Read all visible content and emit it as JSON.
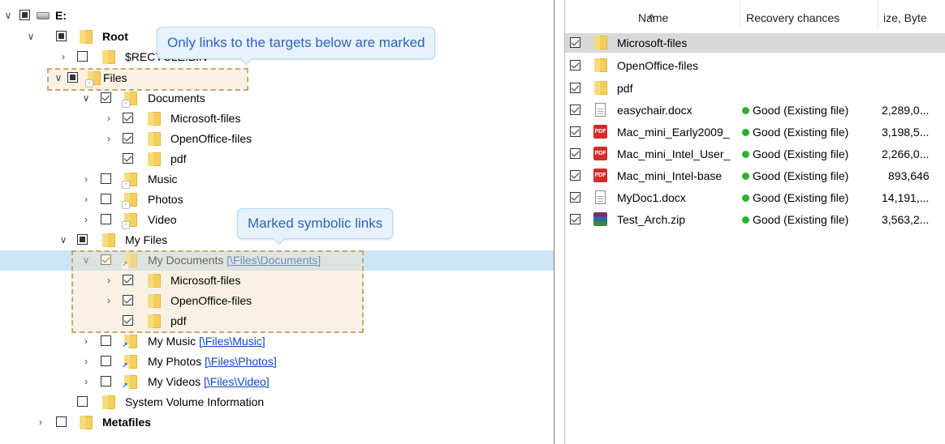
{
  "tree": {
    "drive_label": "E:",
    "root": "Root",
    "recycle": "$RECYCLE.BIN",
    "files": "Files",
    "documents": "Documents",
    "ms_files": "Microsoft-files",
    "oo_files": "OpenOffice-files",
    "pdf": "pdf",
    "music": "Music",
    "photos": "Photos",
    "video": "Video",
    "my_files": "My Files",
    "my_documents": "My Documents",
    "my_documents_target": "[\\Files\\Documents]",
    "my_music": "My Music",
    "my_music_target": "[\\Files\\Music]",
    "my_photos": "My Photos",
    "my_photos_target": "[\\Files\\Photos]",
    "my_videos": "My Videos",
    "my_videos_target": "[\\Files\\Video]",
    "system_volume": "System Volume Information",
    "metafiles": "Metafiles"
  },
  "callouts": {
    "targets": "Only links to the targets below are marked",
    "symlinks": "Marked symbolic links"
  },
  "file_list": {
    "columns": {
      "name": "Name",
      "recovery": "Recovery chances",
      "size": "ize, Byte"
    },
    "rows": [
      {
        "name": "Microsoft-files",
        "recovery": "",
        "size": ""
      },
      {
        "name": "OpenOffice-files",
        "recovery": "",
        "size": ""
      },
      {
        "name": "pdf",
        "recovery": "",
        "size": ""
      },
      {
        "name": "easychair.docx",
        "recovery": "Good (Existing file)",
        "size": "2,289,0..."
      },
      {
        "name": "Mac_mini_Early2009_",
        "recovery": "Good (Existing file)",
        "size": "3,198,5..."
      },
      {
        "name": "Mac_mini_Intel_User_",
        "recovery": "Good (Existing file)",
        "size": "2,266,0..."
      },
      {
        "name": "Mac_mini_Intel-base",
        "recovery": "Good (Existing file)",
        "size": "893,646"
      },
      {
        "name": "MyDoc1.docx",
        "recovery": "Good (Existing file)",
        "size": "14,191,..."
      },
      {
        "name": "Test_Arch.zip",
        "recovery": "Good (Existing file)",
        "size": "3,563,2..."
      }
    ]
  },
  "colors": {
    "selection": "#cce4f7",
    "status_good": "#2cb22c",
    "link": "#0a46c3",
    "callout_text": "#2d63b4"
  },
  "pdf_icon_text": "PDF"
}
